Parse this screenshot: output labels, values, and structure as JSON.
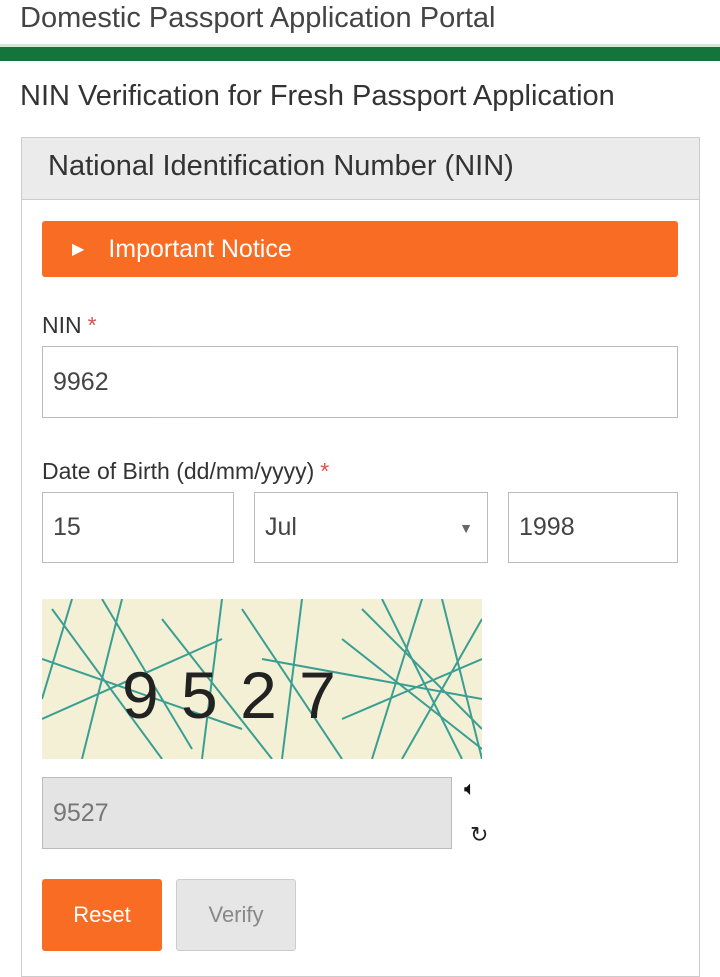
{
  "header": {
    "portal_title": "Domestic Passport Application Portal",
    "brand_color": "#137539"
  },
  "page": {
    "title": "NIN Verification for Fresh Passport Application"
  },
  "panel": {
    "title": "National Identification Number (NIN)"
  },
  "notice": {
    "label": "Important Notice",
    "color": "#f96c23"
  },
  "form": {
    "nin_label": "NIN",
    "required_mark": "*",
    "nin_value": "9962",
    "dob_label": "Date of Birth (dd/mm/yyyy)",
    "day": "15",
    "month": "Jul",
    "year": "1998",
    "captcha_text": "9 5 2 7",
    "captcha_value": "9527",
    "audio_icon": "speaker-icon",
    "refresh_icon": "refresh-icon"
  },
  "buttons": {
    "reset": "Reset",
    "verify": "Verify"
  }
}
